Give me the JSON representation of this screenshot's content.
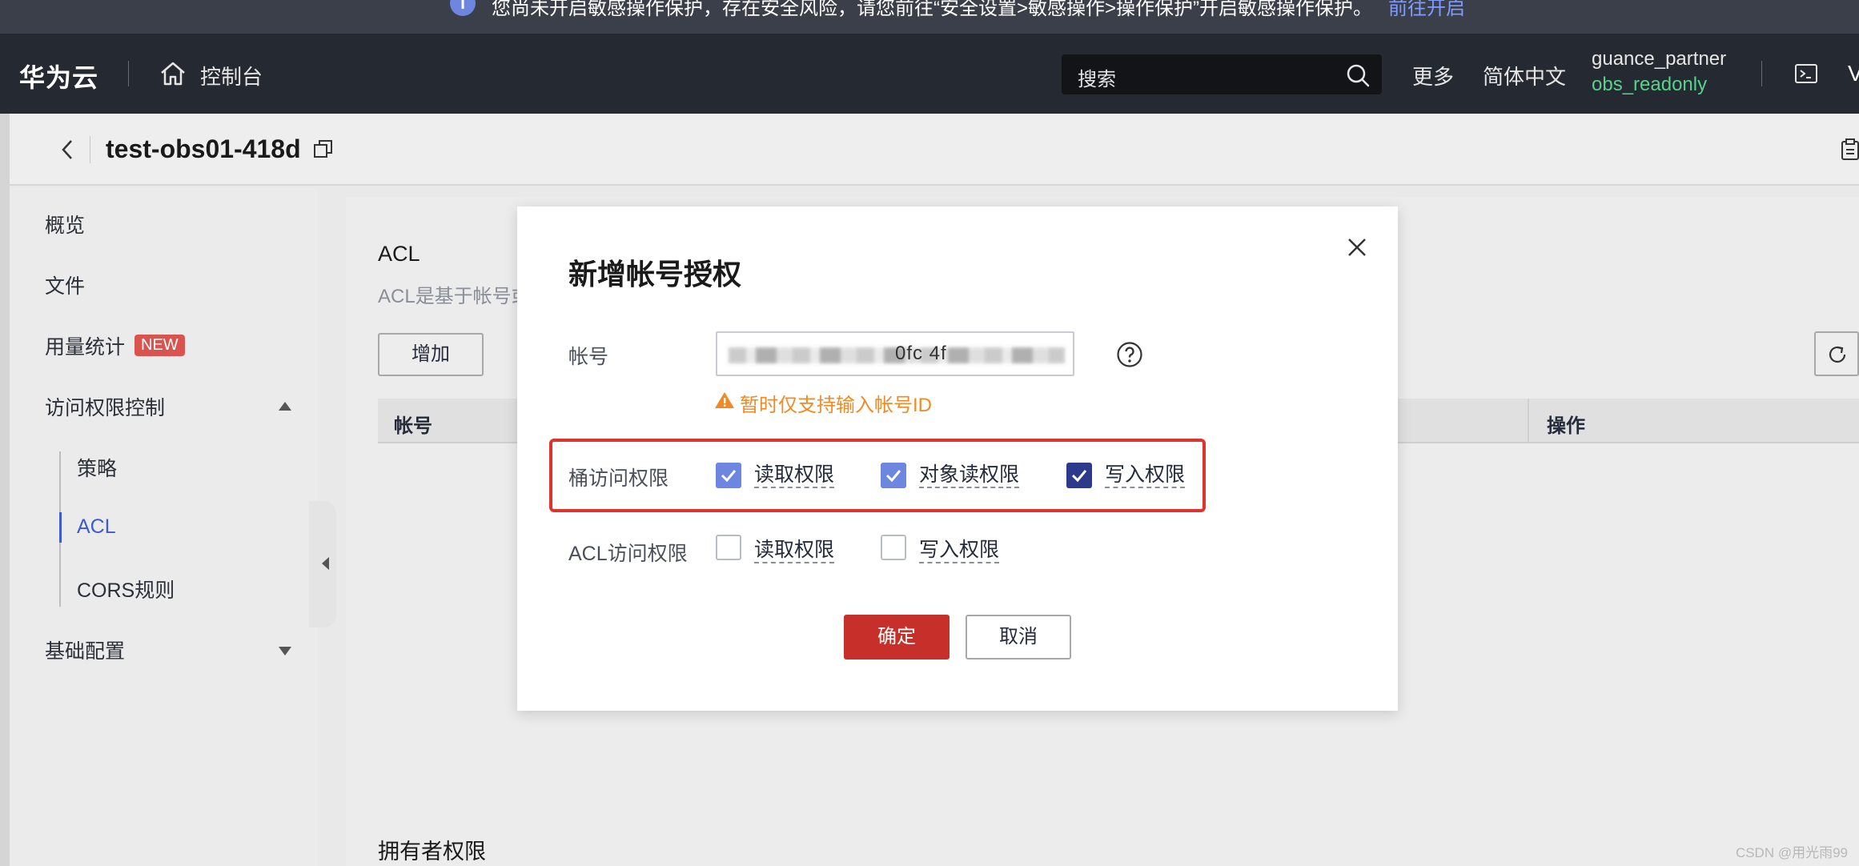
{
  "notice": {
    "message": "您尚未开启敏感操作保护，存在安全风险，请您前往“安全设置>敏感操作>操作保护”开启敏感操作保护。",
    "link": "前往开启"
  },
  "topnav": {
    "logo": "华为云",
    "console": "控制台",
    "search_placeholder": "搜索",
    "more": "更多",
    "language": "简体中文",
    "user_name": "guance_partner",
    "user_role": "obs_readonly",
    "edge_glyph": "V"
  },
  "page": {
    "bucket_title": "test-obs01-418d"
  },
  "sidebar": {
    "items": [
      {
        "label": "概览"
      },
      {
        "label": "文件"
      },
      {
        "label": "用量统计",
        "badge": "NEW"
      },
      {
        "label": "访问权限控制"
      },
      {
        "label": "策略"
      },
      {
        "label": "ACL"
      },
      {
        "label": "CORS规则"
      },
      {
        "label": "基础配置"
      }
    ]
  },
  "content": {
    "acl_title": "ACL",
    "acl_desc": "ACL是基于帐号或",
    "add_button": "增加",
    "table_headers": [
      "帐号",
      "操作"
    ],
    "owner_title": "拥有者权限"
  },
  "modal": {
    "title": "新增帐号授权",
    "account_label": "帐号",
    "account_value_fragment": "0fc     4f",
    "warning": "暂时仅支持输入帐号ID",
    "bucket_access_label": "桶访问权限",
    "bucket_options": [
      {
        "label": "读取权限",
        "checked": true
      },
      {
        "label": "对象读权限",
        "checked": true
      },
      {
        "label": "写入权限",
        "checked": true
      }
    ],
    "acl_access_label": "ACL访问权限",
    "acl_options": [
      {
        "label": "读取权限",
        "checked": false
      },
      {
        "label": "写入权限",
        "checked": false
      }
    ],
    "confirm_button": "确定",
    "cancel_button": "取消"
  },
  "watermark": "CSDN @用光雨99",
  "colors": {
    "accent": "#6d86e0",
    "primary_button": "#c7302a",
    "warning": "#f08a24",
    "highlight_border": "#e0332e",
    "role_green": "#58d18c"
  }
}
